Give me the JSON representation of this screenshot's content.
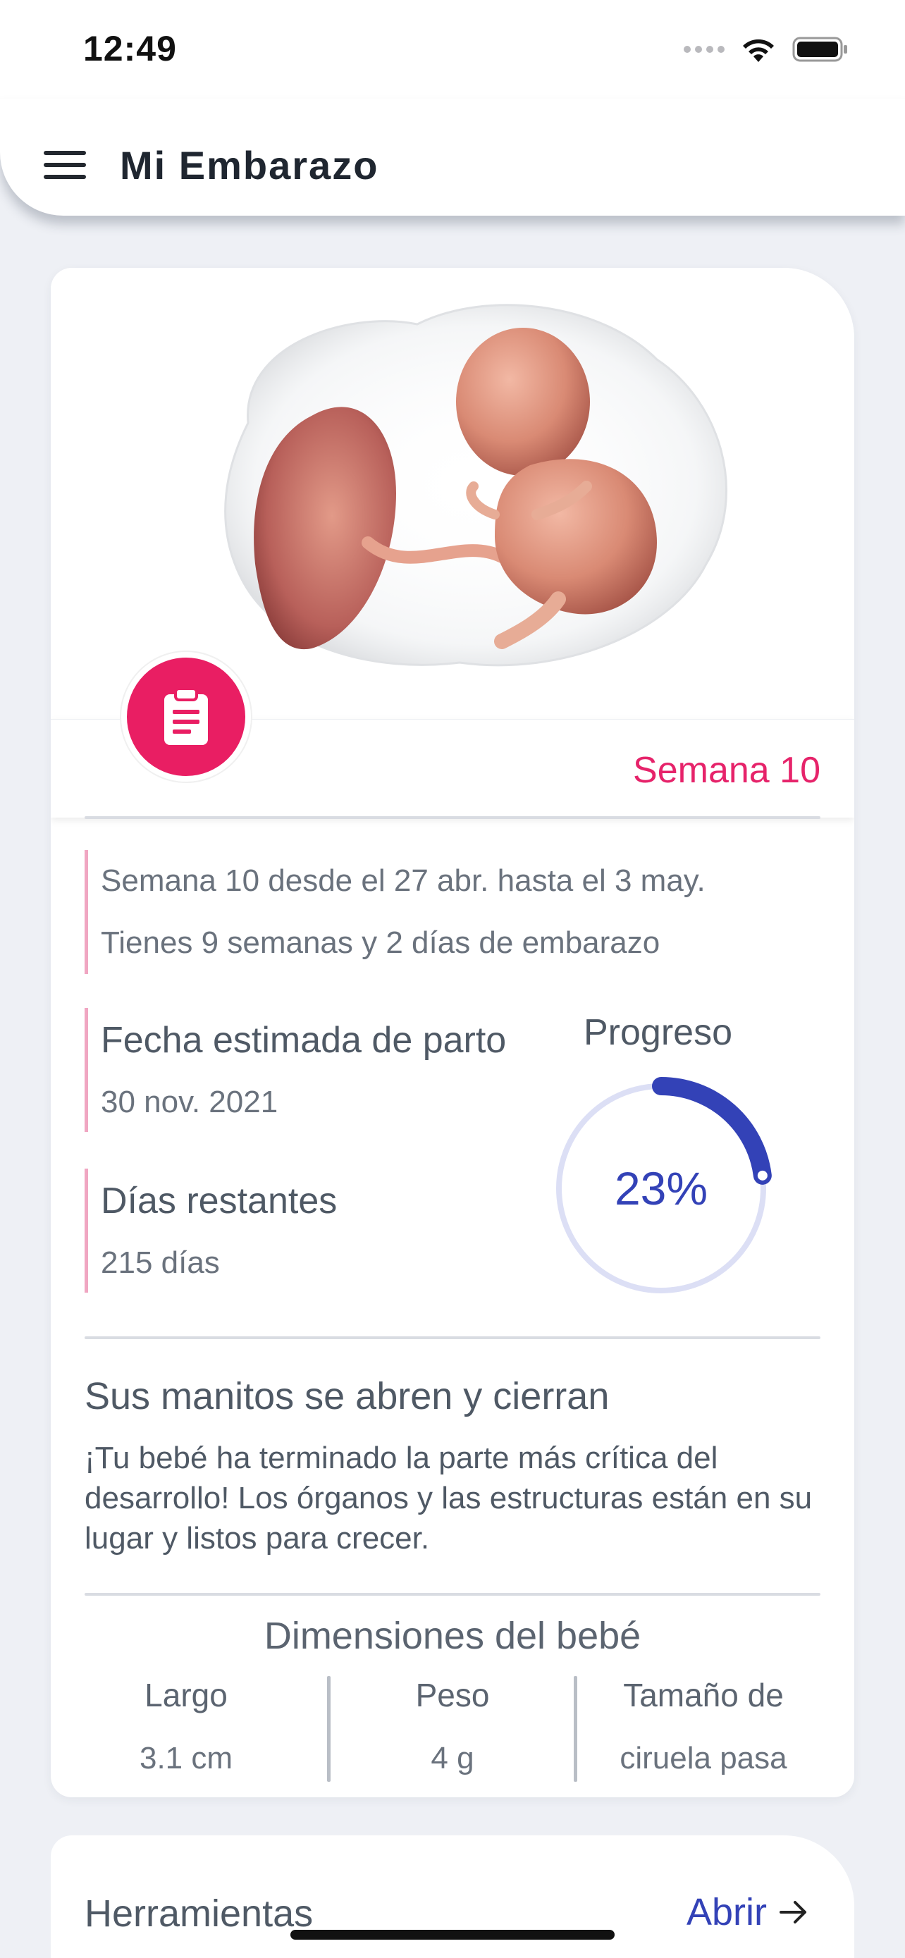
{
  "status_bar": {
    "time": "12:49"
  },
  "app_bar": {
    "title": "Mi Embarazo"
  },
  "hero": {
    "week_label": "Semana 10"
  },
  "week_info": {
    "range": "Semana 10 desde el 27 abr. hasta el 3 may.",
    "pregnancy_time": "Tienes 9 semanas y 2 días de embarazo"
  },
  "due_date": {
    "title": "Fecha estimada de parto",
    "value": "30 nov. 2021"
  },
  "days_left": {
    "title": "Días restantes",
    "value": "215 días"
  },
  "progress": {
    "title": "Progreso",
    "percent_label": "23%",
    "fraction": 0.23
  },
  "development": {
    "title": "Sus manitos se abren y cierran",
    "body": "¡Tu bebé ha terminado la parte más crítica del desarrollo! Los órganos y las estructuras están en su lugar y listos para crecer."
  },
  "dimensions": {
    "title": "Dimensiones del bebé",
    "items": [
      {
        "name": "Largo",
        "value": "3.1 cm"
      },
      {
        "name": "Peso",
        "value": "4 g"
      },
      {
        "name": "Tamaño de",
        "value": "ciruela pasa"
      }
    ]
  },
  "tools": {
    "title": "Herramientas",
    "open_label": "Abrir"
  },
  "colors": {
    "accent_pink": "#e91e63",
    "accent_blue": "#3342b7",
    "background": "#eef0f5"
  },
  "icons": [
    "menu-icon",
    "clipboard-icon",
    "arrow-right-icon",
    "wifi-icon",
    "battery-icon",
    "cellular-icon"
  ]
}
